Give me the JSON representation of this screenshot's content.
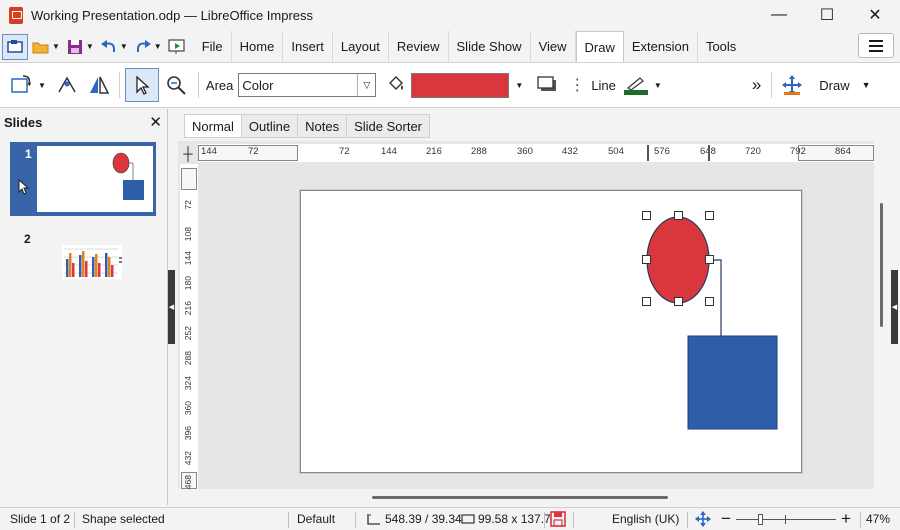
{
  "window": {
    "title": "Working Presentation.odp — LibreOffice Impress",
    "minimize": "—",
    "maximize": "☐",
    "close": "✕"
  },
  "menu": {
    "tabs": [
      "File",
      "Home",
      "Insert",
      "Layout",
      "Review",
      "Slide Show",
      "View",
      "Draw",
      "Extension",
      "Tools"
    ],
    "active": "Draw"
  },
  "toolbar": {
    "area_label": "Area",
    "area_value": "Color",
    "area_color": "#d9363e",
    "line_label": "Line",
    "line_color": "#1e6b2a",
    "more_label": "»",
    "draw_label": "Draw"
  },
  "slides_panel": {
    "title": "Slides",
    "close": "✕",
    "slides": [
      {
        "number": "1"
      },
      {
        "number": "2"
      }
    ]
  },
  "view_tabs": [
    "Normal",
    "Outline",
    "Notes",
    "Slide Sorter"
  ],
  "ruler_h": [
    "144",
    "72",
    "72",
    "144",
    "216",
    "288",
    "360",
    "432",
    "504",
    "576",
    "648",
    "720",
    "792",
    "864"
  ],
  "ruler_v": [
    "72",
    "108",
    "144",
    "180",
    "216",
    "252",
    "288",
    "324",
    "360",
    "396",
    "432",
    "468"
  ],
  "shapes": {
    "ellipse_color": "#d9363e",
    "rect_color": "#2e5ea8"
  },
  "status": {
    "slide": "Slide 1 of 2",
    "selection": "Shape selected",
    "master": "Default",
    "position": "548.39 / 39.34",
    "size": "99.58 x 137.7",
    "language": "English (UK)",
    "zoom_minus": "−",
    "zoom_plus": "+",
    "zoom": "47%"
  }
}
